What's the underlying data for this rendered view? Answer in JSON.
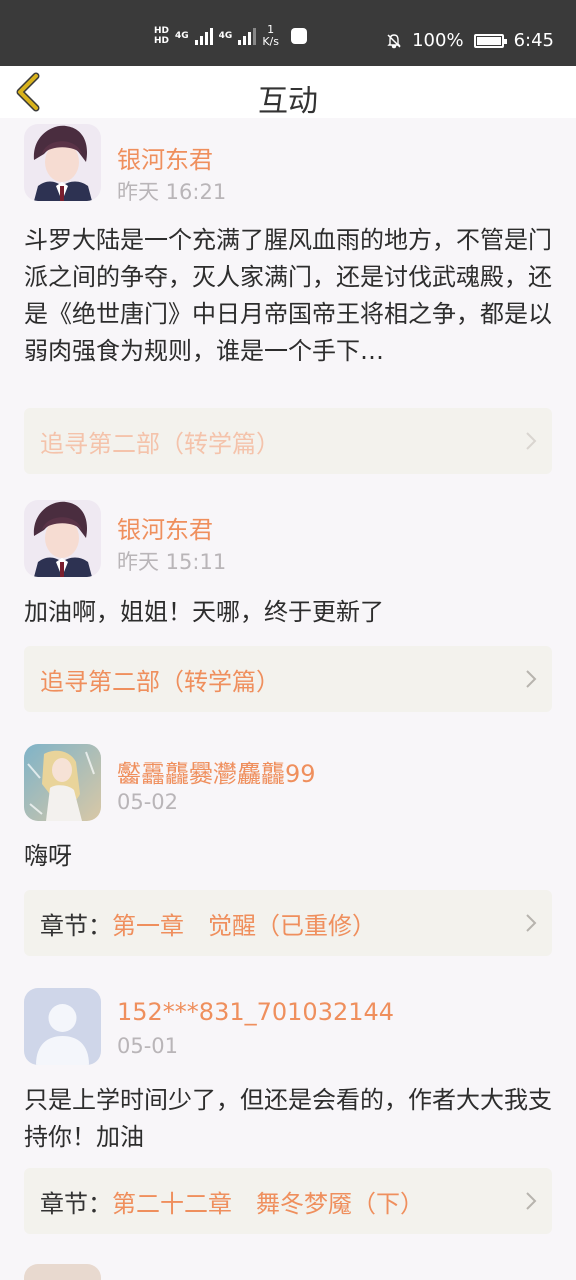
{
  "status_bar": {
    "hd1": "HD",
    "hd2": "HD",
    "net1": "4G",
    "net2": "4G",
    "speed_value": "1",
    "speed_unit": "K/s",
    "battery": "100%",
    "time": "6:45"
  },
  "header": {
    "title": "互动"
  },
  "comments": [
    {
      "user": "银河东君",
      "time": "昨天 16:21",
      "text": "斗罗大陆是一个充满了腥风血雨的地方，不管是门派之间的争夺，灭人家满门，还是讨伐武魂殿，还是《绝世唐门》中日月帝国帝王将相之争，都是以弱肉强食为规则，谁是一个手下…",
      "link_label": "",
      "link_value": "追寻第二部（转学篇）"
    },
    {
      "user": "银河东君",
      "time": "昨天 15:11",
      "text": "加油啊，姐姐！天哪，终于更新了",
      "link_label": "",
      "link_value": "追寻第二部（转学篇）"
    },
    {
      "user": "齾靐龘爨灪麤龘99",
      "time": "05-02",
      "text": "嗨呀",
      "link_label": "章节：",
      "link_value": "第一章　觉醒（已重修）"
    },
    {
      "user": "152***831_701032144",
      "time": "05-01",
      "text": "只是上学时间少了，但还是会看的，作者大大我支持你！加油",
      "link_label": "章节：",
      "link_value": "第二十二章　舞冬梦魇（下）"
    }
  ],
  "colors": {
    "accent": "#ef8f5d",
    "background": "#f8f6f9",
    "link_box": "#f3f2ed",
    "status_bar": "#3a3a3a",
    "back_icon": "#d8b21c"
  }
}
